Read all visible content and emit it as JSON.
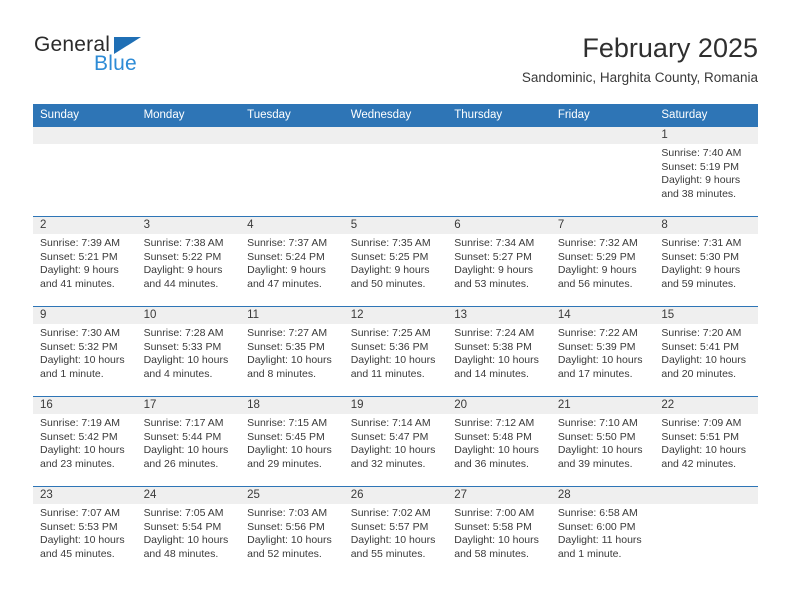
{
  "brand": {
    "line1": "General",
    "line2": "Blue",
    "mark": "blue-triangle"
  },
  "header": {
    "month_title": "February 2025",
    "location": "Sandominic, Harghita County, Romania"
  },
  "colors": {
    "header_blue": "#2e75b6",
    "brand_blue": "#2d8bd6",
    "daynum_band": "#efefef",
    "text": "#3a3a3a"
  },
  "calendar": {
    "weekday_headers": [
      "Sunday",
      "Monday",
      "Tuesday",
      "Wednesday",
      "Thursday",
      "Friday",
      "Saturday"
    ],
    "weeks": [
      [
        {
          "empty": true
        },
        {
          "empty": true
        },
        {
          "empty": true
        },
        {
          "empty": true
        },
        {
          "empty": true
        },
        {
          "empty": true
        },
        {
          "day": "1",
          "sunrise": "Sunrise: 7:40 AM",
          "sunset": "Sunset: 5:19 PM",
          "daylight": "Daylight: 9 hours and 38 minutes."
        }
      ],
      [
        {
          "day": "2",
          "sunrise": "Sunrise: 7:39 AM",
          "sunset": "Sunset: 5:21 PM",
          "daylight": "Daylight: 9 hours and 41 minutes."
        },
        {
          "day": "3",
          "sunrise": "Sunrise: 7:38 AM",
          "sunset": "Sunset: 5:22 PM",
          "daylight": "Daylight: 9 hours and 44 minutes."
        },
        {
          "day": "4",
          "sunrise": "Sunrise: 7:37 AM",
          "sunset": "Sunset: 5:24 PM",
          "daylight": "Daylight: 9 hours and 47 minutes."
        },
        {
          "day": "5",
          "sunrise": "Sunrise: 7:35 AM",
          "sunset": "Sunset: 5:25 PM",
          "daylight": "Daylight: 9 hours and 50 minutes."
        },
        {
          "day": "6",
          "sunrise": "Sunrise: 7:34 AM",
          "sunset": "Sunset: 5:27 PM",
          "daylight": "Daylight: 9 hours and 53 minutes."
        },
        {
          "day": "7",
          "sunrise": "Sunrise: 7:32 AM",
          "sunset": "Sunset: 5:29 PM",
          "daylight": "Daylight: 9 hours and 56 minutes."
        },
        {
          "day": "8",
          "sunrise": "Sunrise: 7:31 AM",
          "sunset": "Sunset: 5:30 PM",
          "daylight": "Daylight: 9 hours and 59 minutes."
        }
      ],
      [
        {
          "day": "9",
          "sunrise": "Sunrise: 7:30 AM",
          "sunset": "Sunset: 5:32 PM",
          "daylight": "Daylight: 10 hours and 1 minute."
        },
        {
          "day": "10",
          "sunrise": "Sunrise: 7:28 AM",
          "sunset": "Sunset: 5:33 PM",
          "daylight": "Daylight: 10 hours and 4 minutes."
        },
        {
          "day": "11",
          "sunrise": "Sunrise: 7:27 AM",
          "sunset": "Sunset: 5:35 PM",
          "daylight": "Daylight: 10 hours and 8 minutes."
        },
        {
          "day": "12",
          "sunrise": "Sunrise: 7:25 AM",
          "sunset": "Sunset: 5:36 PM",
          "daylight": "Daylight: 10 hours and 11 minutes."
        },
        {
          "day": "13",
          "sunrise": "Sunrise: 7:24 AM",
          "sunset": "Sunset: 5:38 PM",
          "daylight": "Daylight: 10 hours and 14 minutes."
        },
        {
          "day": "14",
          "sunrise": "Sunrise: 7:22 AM",
          "sunset": "Sunset: 5:39 PM",
          "daylight": "Daylight: 10 hours and 17 minutes."
        },
        {
          "day": "15",
          "sunrise": "Sunrise: 7:20 AM",
          "sunset": "Sunset: 5:41 PM",
          "daylight": "Daylight: 10 hours and 20 minutes."
        }
      ],
      [
        {
          "day": "16",
          "sunrise": "Sunrise: 7:19 AM",
          "sunset": "Sunset: 5:42 PM",
          "daylight": "Daylight: 10 hours and 23 minutes."
        },
        {
          "day": "17",
          "sunrise": "Sunrise: 7:17 AM",
          "sunset": "Sunset: 5:44 PM",
          "daylight": "Daylight: 10 hours and 26 minutes."
        },
        {
          "day": "18",
          "sunrise": "Sunrise: 7:15 AM",
          "sunset": "Sunset: 5:45 PM",
          "daylight": "Daylight: 10 hours and 29 minutes."
        },
        {
          "day": "19",
          "sunrise": "Sunrise: 7:14 AM",
          "sunset": "Sunset: 5:47 PM",
          "daylight": "Daylight: 10 hours and 32 minutes."
        },
        {
          "day": "20",
          "sunrise": "Sunrise: 7:12 AM",
          "sunset": "Sunset: 5:48 PM",
          "daylight": "Daylight: 10 hours and 36 minutes."
        },
        {
          "day": "21",
          "sunrise": "Sunrise: 7:10 AM",
          "sunset": "Sunset: 5:50 PM",
          "daylight": "Daylight: 10 hours and 39 minutes."
        },
        {
          "day": "22",
          "sunrise": "Sunrise: 7:09 AM",
          "sunset": "Sunset: 5:51 PM",
          "daylight": "Daylight: 10 hours and 42 minutes."
        }
      ],
      [
        {
          "day": "23",
          "sunrise": "Sunrise: 7:07 AM",
          "sunset": "Sunset: 5:53 PM",
          "daylight": "Daylight: 10 hours and 45 minutes."
        },
        {
          "day": "24",
          "sunrise": "Sunrise: 7:05 AM",
          "sunset": "Sunset: 5:54 PM",
          "daylight": "Daylight: 10 hours and 48 minutes."
        },
        {
          "day": "25",
          "sunrise": "Sunrise: 7:03 AM",
          "sunset": "Sunset: 5:56 PM",
          "daylight": "Daylight: 10 hours and 52 minutes."
        },
        {
          "day": "26",
          "sunrise": "Sunrise: 7:02 AM",
          "sunset": "Sunset: 5:57 PM",
          "daylight": "Daylight: 10 hours and 55 minutes."
        },
        {
          "day": "27",
          "sunrise": "Sunrise: 7:00 AM",
          "sunset": "Sunset: 5:58 PM",
          "daylight": "Daylight: 10 hours and 58 minutes."
        },
        {
          "day": "28",
          "sunrise": "Sunrise: 6:58 AM",
          "sunset": "Sunset: 6:00 PM",
          "daylight": "Daylight: 11 hours and 1 minute."
        },
        {
          "empty": true
        }
      ]
    ]
  }
}
